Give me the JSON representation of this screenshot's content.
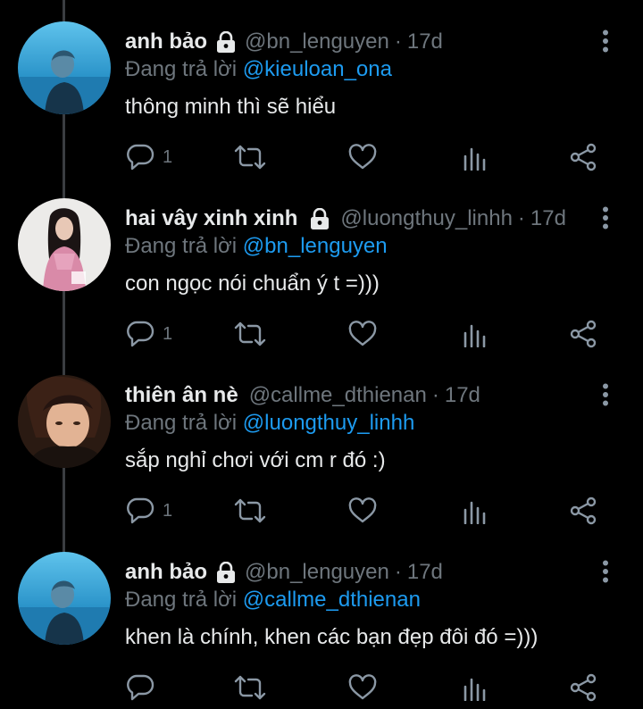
{
  "colors": {
    "background": "#000000",
    "text": "#e7e9ea",
    "secondary": "#6e767d",
    "accent": "#1d9bf0",
    "icon": "#8b98a5"
  },
  "reply_prefix": "Đang trả lời",
  "tweets": [
    {
      "display_name": "anh bảo",
      "handle": "@bn_lenguyen",
      "time": "17d",
      "reply_to": "@kieuloan_ona",
      "text": "thông minh thì sẽ hiểu",
      "reply_count": "1",
      "avatar": "blue-sky-avatar"
    },
    {
      "display_name": "hai vây xinh xinh",
      "handle": "@luongthuy_linhh",
      "time": "17d",
      "reply_to": "@bn_lenguyen",
      "text": "con ngọc nói chuẩn ý t =)))",
      "reply_count": "1",
      "avatar": "girl-pink-avatar"
    },
    {
      "display_name": "thiên ân nè",
      "handle": "@callme_dthienan",
      "time": "17d",
      "reply_to": "@luongthuy_linhh",
      "text": "sắp nghỉ chơi với cm r đó :)",
      "reply_count": "1",
      "avatar": "warm-portrait-avatar"
    },
    {
      "display_name": "anh bảo",
      "handle": "@bn_lenguyen",
      "time": "17d",
      "reply_to": "@callme_dthienan",
      "text": "khen là chính, khen các bạn đẹp đôi đó =)))",
      "reply_count": "",
      "avatar": "blue-sky-avatar"
    }
  ]
}
